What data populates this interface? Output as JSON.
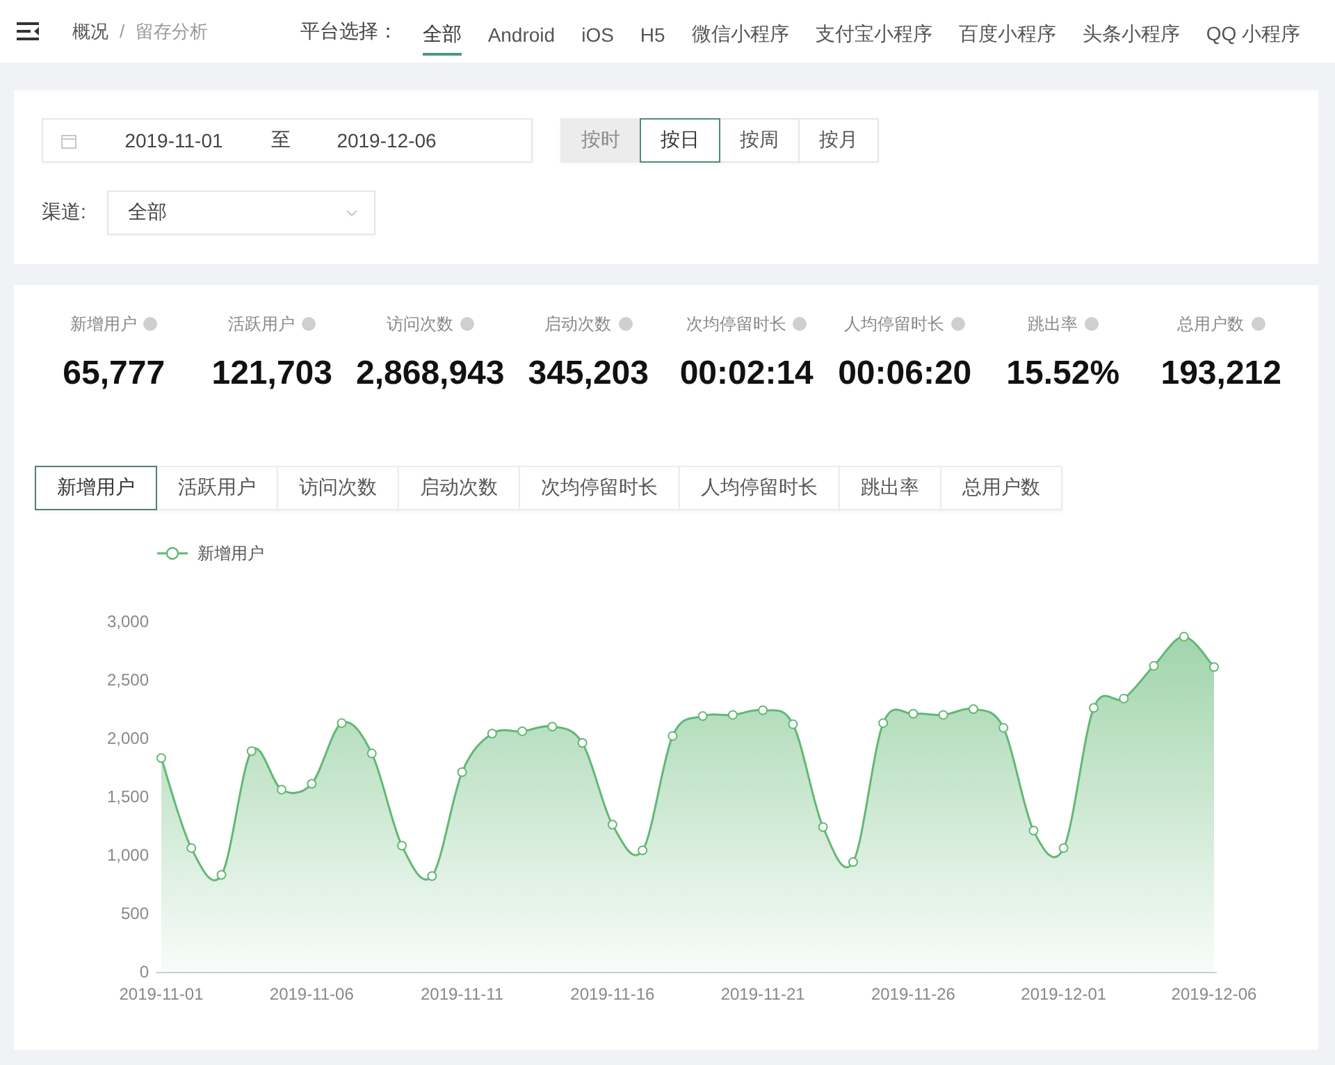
{
  "top_bar": {
    "breadcrumb": [
      {
        "label": "概况",
        "current": false
      },
      {
        "label": "留存分析",
        "current": true
      }
    ],
    "breadcrumb_separator": "/",
    "platform_label": "平台选择：",
    "platforms": [
      {
        "label": "全部",
        "selected": true
      },
      {
        "label": "Android",
        "selected": false
      },
      {
        "label": "iOS",
        "selected": false
      },
      {
        "label": "H5",
        "selected": false
      },
      {
        "label": "微信小程序",
        "selected": false
      },
      {
        "label": "支付宝小程序",
        "selected": false
      },
      {
        "label": "百度小程序",
        "selected": false
      },
      {
        "label": "头条小程序",
        "selected": false
      },
      {
        "label": "QQ 小程序",
        "selected": false
      }
    ]
  },
  "filters": {
    "date_range": {
      "start": "2019-11-01",
      "separator": "至",
      "end": "2019-12-06"
    },
    "granularity": [
      {
        "label": "按时",
        "selected": false,
        "disabled": true
      },
      {
        "label": "按日",
        "selected": true,
        "disabled": false
      },
      {
        "label": "按周",
        "selected": false,
        "disabled": false
      },
      {
        "label": "按月",
        "selected": false,
        "disabled": false
      }
    ],
    "channel": {
      "label": "渠道:",
      "value": "全部"
    }
  },
  "stats": [
    {
      "label": "新增用户",
      "value": "65,777"
    },
    {
      "label": "活跃用户",
      "value": "121,703"
    },
    {
      "label": "访问次数",
      "value": "2,868,943"
    },
    {
      "label": "启动次数",
      "value": "345,203"
    },
    {
      "label": "次均停留时长",
      "value": "00:02:14"
    },
    {
      "label": "人均停留时长",
      "value": "00:06:20"
    },
    {
      "label": "跳出率",
      "value": "15.52%"
    },
    {
      "label": "总用户数",
      "value": "193,212"
    }
  ],
  "metric_tabs": [
    {
      "label": "新增用户",
      "selected": true
    },
    {
      "label": "活跃用户",
      "selected": false
    },
    {
      "label": "访问次数",
      "selected": false
    },
    {
      "label": "启动次数",
      "selected": false
    },
    {
      "label": "次均停留时长",
      "selected": false
    },
    {
      "label": "人均停留时长",
      "selected": false
    },
    {
      "label": "跳出率",
      "selected": false
    },
    {
      "label": "总用户数",
      "selected": false
    }
  ],
  "chart": {
    "chart_data": {
      "type": "area",
      "categories": [
        "2019-11-01",
        null,
        null,
        null,
        null,
        "2019-11-06",
        null,
        null,
        null,
        null,
        "2019-11-11",
        null,
        null,
        null,
        null,
        "2019-11-16",
        null,
        null,
        null,
        null,
        "2019-11-21",
        null,
        null,
        null,
        null,
        "2019-11-26",
        null,
        null,
        null,
        null,
        "2019-12-01",
        null,
        null,
        null,
        null,
        "2019-12-06"
      ],
      "ylim": [
        0,
        3000
      ],
      "yticks": [
        {
          "value": 0,
          "label": "0"
        },
        {
          "value": 500,
          "label": "500"
        },
        {
          "value": 1000,
          "label": "1,000"
        },
        {
          "value": 1500,
          "label": "1,500"
        },
        {
          "value": 2000,
          "label": "2,000"
        },
        {
          "value": 2500,
          "label": "2,500"
        },
        {
          "value": 3000,
          "label": "3,000"
        }
      ],
      "series": [
        {
          "name": "新增用户",
          "color": "#62b874",
          "values": [
            1830,
            1060,
            830,
            1890,
            1560,
            1610,
            2130,
            1870,
            1080,
            820,
            1710,
            2040,
            2060,
            2100,
            1960,
            1260,
            1040,
            2020,
            2190,
            2200,
            2240,
            2120,
            1240,
            940,
            2130,
            2210,
            2200,
            2250,
            2090,
            1210,
            1060,
            2260,
            2340,
            2620,
            2870,
            2610
          ]
        }
      ]
    }
  }
}
